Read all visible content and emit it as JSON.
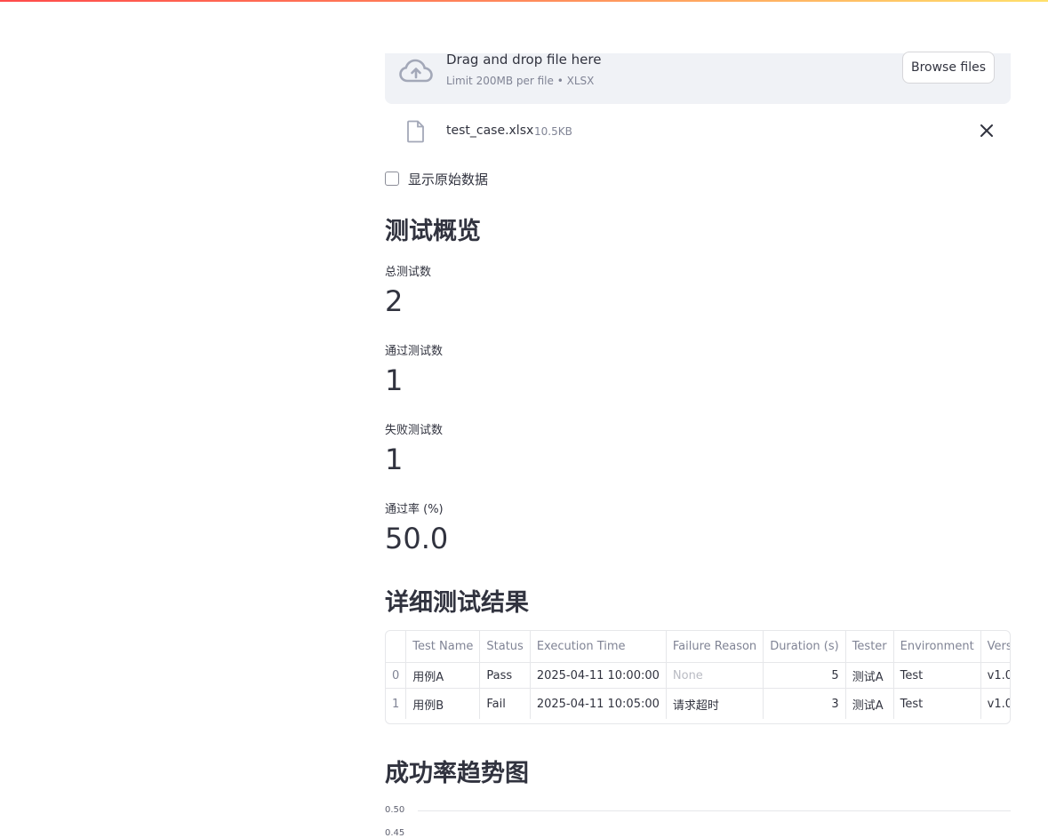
{
  "uploader": {
    "title": "Drag and drop file here",
    "hint": "Limit 200MB per file • XLSX",
    "browse_label": "Browse files"
  },
  "file": {
    "name": "test_case.xlsx",
    "size": "10.5KB"
  },
  "raw_checkbox": {
    "label": "显示原始数据",
    "checked": false
  },
  "overview": {
    "heading": "测试概览",
    "metrics": [
      {
        "label": "总测试数",
        "value": "2"
      },
      {
        "label": "通过测试数",
        "value": "1"
      },
      {
        "label": "失败测试数",
        "value": "1"
      },
      {
        "label": "通过率 (%)",
        "value": "50.0"
      }
    ]
  },
  "results": {
    "heading": "详细测试结果",
    "columns": [
      "",
      "Test Name",
      "Status",
      "Execution Time",
      "Failure Reason",
      "Duration (s)",
      "Tester",
      "Environment",
      "Version"
    ],
    "rows": [
      [
        "0",
        "用例A",
        "Pass",
        "2025-04-11 10:00:00",
        "None",
        "5",
        "测试A",
        "Test",
        "v1.0"
      ],
      [
        "1",
        "用例B",
        "Fail",
        "2025-04-11 10:05:00",
        "请求超时",
        "3",
        "测试A",
        "Test",
        "v1.0"
      ]
    ]
  },
  "trend": {
    "heading": "成功率趋势图"
  },
  "chart_data": {
    "type": "line",
    "y_ticks": [
      "0.50",
      "0.45"
    ],
    "grid": true
  }
}
